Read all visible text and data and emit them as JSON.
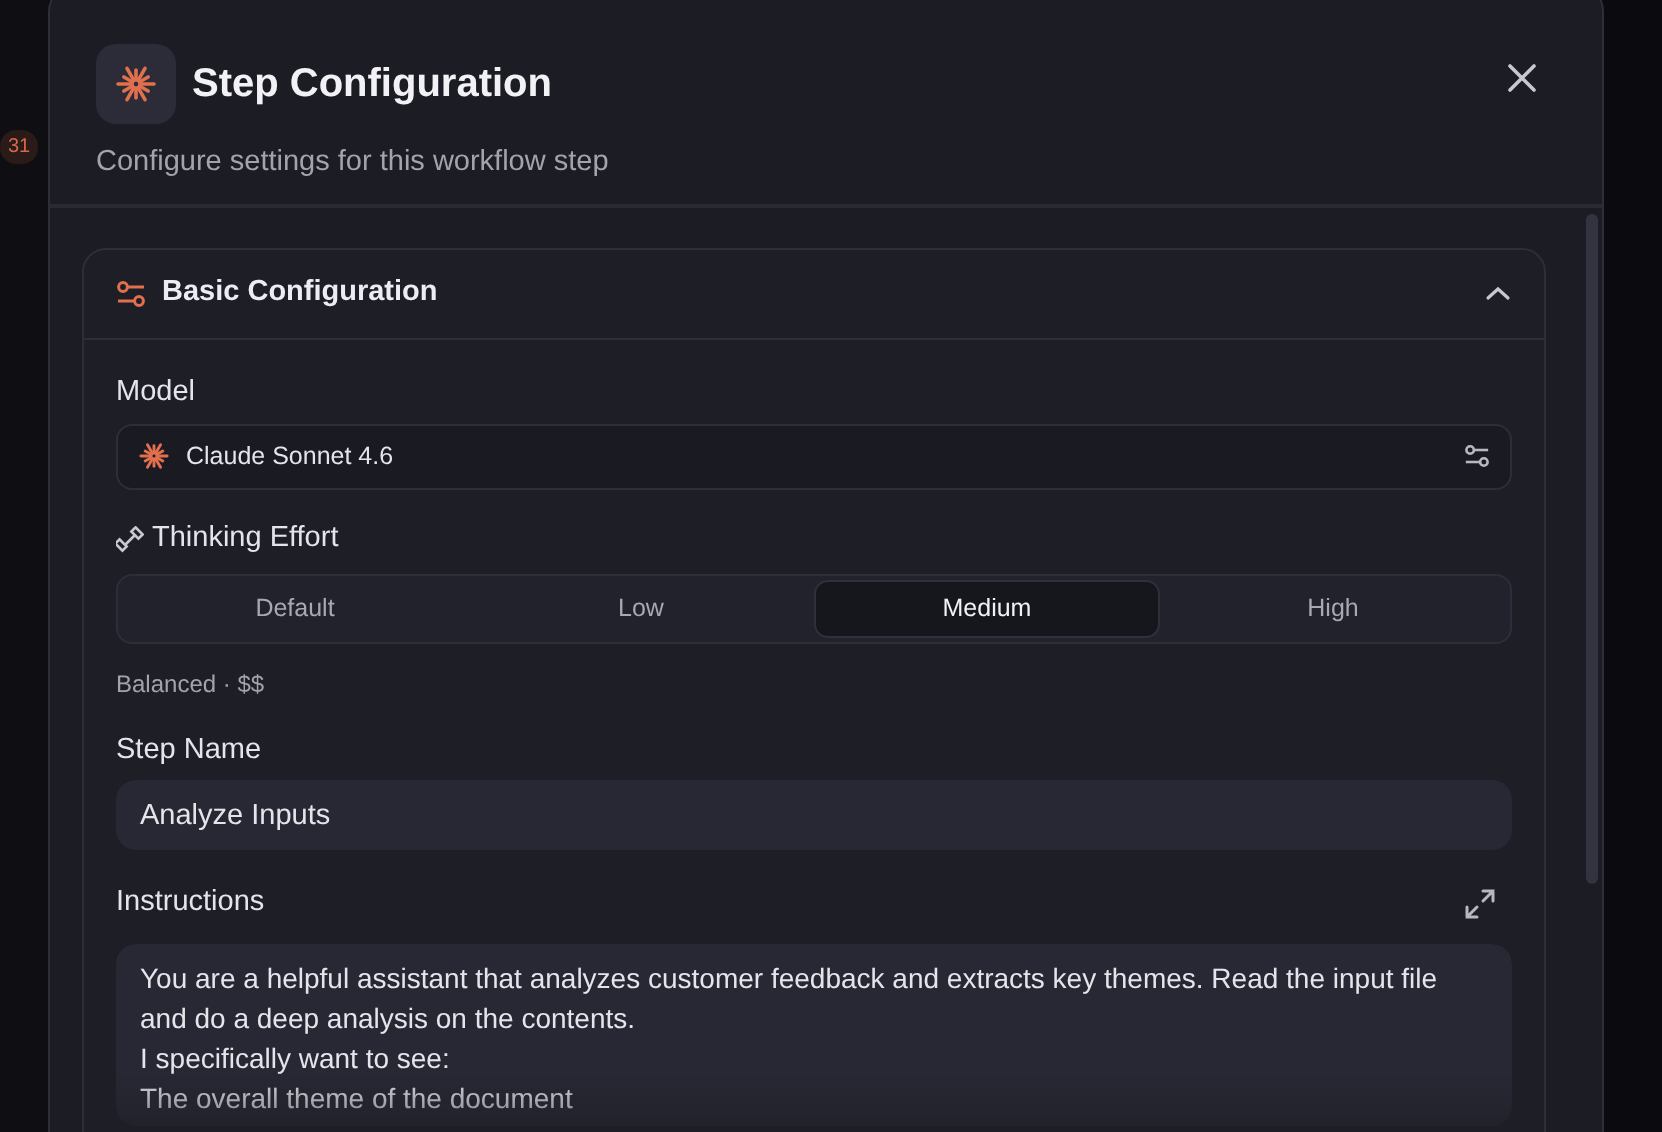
{
  "background": {
    "badge": "31"
  },
  "dialog": {
    "title": "Step Configuration",
    "subtitle": "Configure settings for this workflow step"
  },
  "section": {
    "title": "Basic Configuration",
    "expanded": true
  },
  "model": {
    "label": "Model",
    "value": "Claude Sonnet 4.6"
  },
  "thinking_effort": {
    "label": "Thinking Effort",
    "options": [
      {
        "label": "Default",
        "selected": false
      },
      {
        "label": "Low",
        "selected": false
      },
      {
        "label": "Medium",
        "selected": true
      },
      {
        "label": "High",
        "selected": false
      }
    ],
    "hint": "Balanced · $$"
  },
  "step_name": {
    "label": "Step Name",
    "value": "Analyze Inputs"
  },
  "instructions": {
    "label": "Instructions",
    "value": "You are a helpful assistant that analyzes customer feedback and extracts key themes. Read the input file and do a deep analysis on the contents.\nI specifically want to see:\nThe overall theme of the document"
  }
}
